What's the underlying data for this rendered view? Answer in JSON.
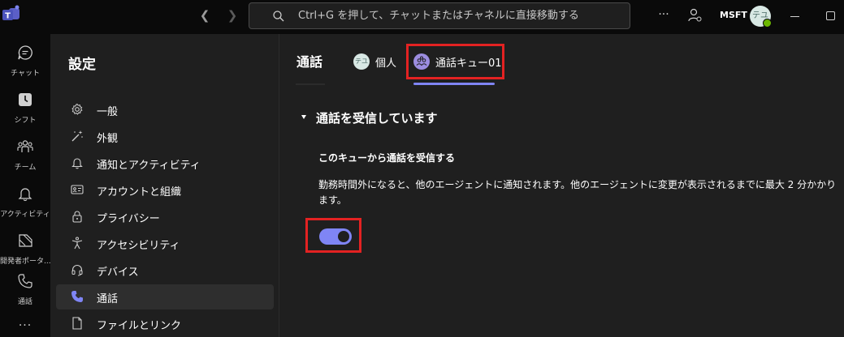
{
  "search": {
    "placeholder": "Ctrl+G を押して、チャットまたはチャネルに直接移動する"
  },
  "titlebar": {
    "more_label": "···",
    "org_name": "MSFT",
    "avatar_initials": "テユ",
    "presence": "available"
  },
  "rail": {
    "items": [
      {
        "label": "チャット",
        "icon": "chat-icon"
      },
      {
        "label": "シフト",
        "icon": "shifts-icon"
      },
      {
        "label": "チーム",
        "icon": "teams-icon"
      },
      {
        "label": "アクティビティ",
        "icon": "bell-icon"
      },
      {
        "label": "開発者ポータ...",
        "icon": "developer-portal-icon"
      },
      {
        "label": "通話",
        "icon": "phone-icon"
      }
    ],
    "more_label": "···"
  },
  "settings": {
    "title": "設定",
    "items": [
      {
        "label": "一般",
        "icon": "gear-icon"
      },
      {
        "label": "外観",
        "icon": "magic-wand-icon"
      },
      {
        "label": "通知とアクティビティ",
        "icon": "bell-icon"
      },
      {
        "label": "アカウントと組織",
        "icon": "id-card-icon"
      },
      {
        "label": "プライバシー",
        "icon": "lock-icon"
      },
      {
        "label": "アクセシビリティ",
        "icon": "accessibility-icon"
      },
      {
        "label": "デバイス",
        "icon": "headset-icon"
      },
      {
        "label": "通話",
        "icon": "phone-icon",
        "active": true
      },
      {
        "label": "ファイルとリンク",
        "icon": "file-icon"
      }
    ]
  },
  "main": {
    "title": "通話",
    "tabs": [
      {
        "label": "個人",
        "avatar": "テユ"
      },
      {
        "label": "通話キュー01",
        "selected": true
      }
    ],
    "section": {
      "title": "通話を受信しています",
      "setting_label": "このキューから通話を受信する",
      "description": "勤務時間外になると、他のエージェントに通知されます。他のエージェントに変更が表示されるまでに最大 2 分かかります。",
      "toggle_on": true
    }
  },
  "colors": {
    "accent": "#7f85f5",
    "highlight": "#e32222",
    "background": "#1f1f1f",
    "rail": "#0a0a0a"
  }
}
